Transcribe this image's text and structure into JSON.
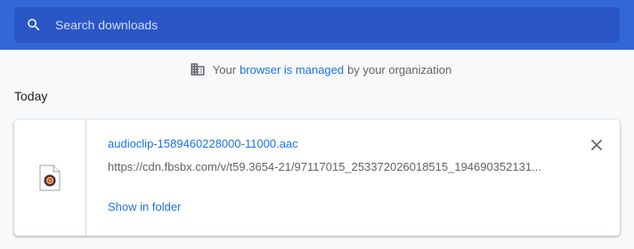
{
  "search": {
    "placeholder": "Search downloads",
    "icon": "search-icon"
  },
  "managed_notice": {
    "prefix": "Your",
    "link": "browser is managed",
    "suffix": "by your organization",
    "icon": "building-icon"
  },
  "section": {
    "title": "Today"
  },
  "download": {
    "file_name": "audioclip-1589460228000-11000.aac",
    "url": "https://cdn.fbsbx.com/v/t59.3654-21/97117015_253372026018515_194690352131...",
    "show_in_folder": "Show in folder",
    "file_icon": "audio-file-icon",
    "close_icon": "close-icon"
  },
  "colors": {
    "header": "#3367d6",
    "search_bg": "#2a56c6",
    "link": "#1a73e8",
    "background": "#f8f9fa"
  }
}
